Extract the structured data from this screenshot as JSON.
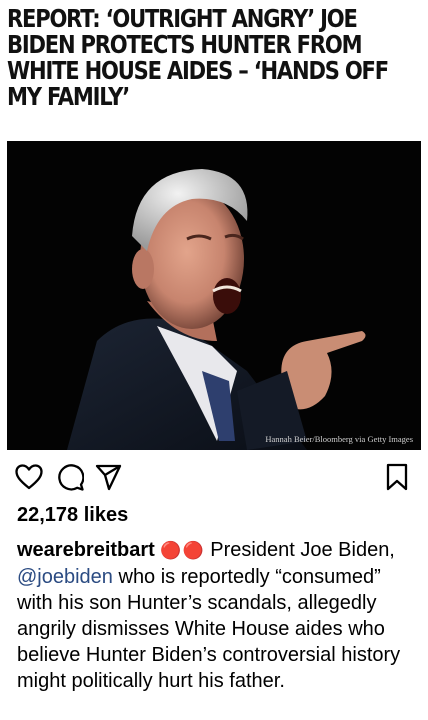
{
  "post": {
    "headline": "REPORT: ‘OUTRIGHT ANGRY’ JOE BIDEN PROTECTS HUNTER FROM WHITE HOUSE AIDES – ‘HANDS OFF MY FAMILY’",
    "image_alt": "Joe Biden shouting and pointing",
    "image_credit": "Hannah Beier/Bloomberg via Getty Images"
  },
  "actions": {
    "like_icon": "heart-outline-icon",
    "comment_icon": "speech-bubble-icon",
    "share_icon": "paper-plane-icon",
    "save_icon": "bookmark-icon"
  },
  "likes": {
    "label": "22,178 likes"
  },
  "caption": {
    "username": "wearebreitbart",
    "emoji": "🔴🔴",
    "text_before_mention": " President Joe Biden, ",
    "mention": "@joebiden",
    "text_after_mention": " who is reportedly “consumed” with his son Hunter’s scandals, allegedly angrily dismisses White House aides who believe Hunter Biden’s controversial history might politically hurt his father."
  },
  "colors": {
    "mention": "#2b4b82",
    "emoji_red": "#d12a2a",
    "photo_bg": "#030303"
  }
}
